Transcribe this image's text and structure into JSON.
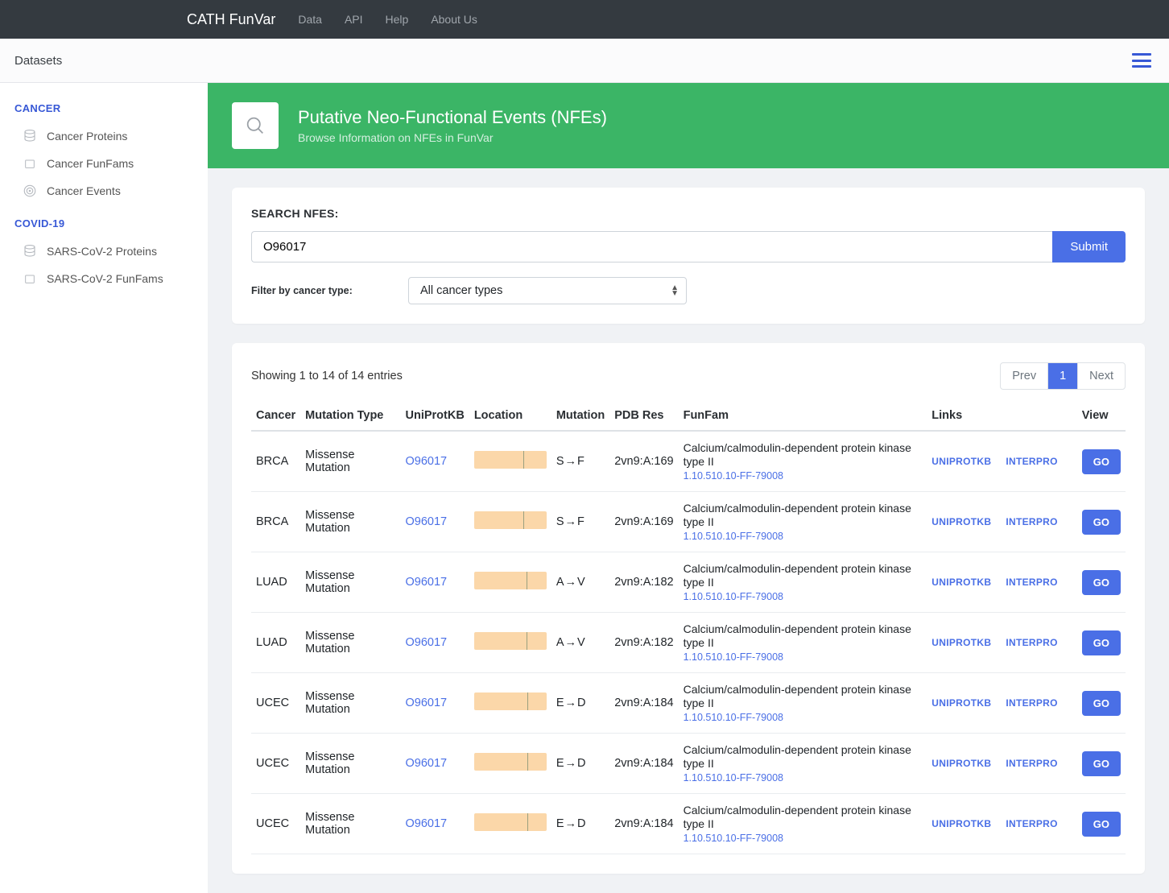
{
  "topnav": {
    "brand": "CATH FunVar",
    "links": [
      "Data",
      "API",
      "Help",
      "About Us"
    ]
  },
  "secbar": {
    "label": "Datasets"
  },
  "sidebar": {
    "groups": [
      {
        "title": "CANCER",
        "items": [
          {
            "label": "Cancer Proteins",
            "icon": "db"
          },
          {
            "label": "Cancer FunFams",
            "icon": "box"
          },
          {
            "label": "Cancer Events",
            "icon": "target"
          }
        ]
      },
      {
        "title": "COVID-19",
        "items": [
          {
            "label": "SARS-CoV-2 Proteins",
            "icon": "db"
          },
          {
            "label": "SARS-CoV-2 FunFams",
            "icon": "box"
          }
        ]
      }
    ]
  },
  "hero": {
    "title": "Putative Neo-Functional Events (NFEs)",
    "subtitle": "Browse Information on NFEs in FunVar"
  },
  "search": {
    "title": "SEARCH NFES:",
    "value": "O96017",
    "submit": "Submit",
    "filter_label": "Filter by cancer type:",
    "filter_value": "All cancer types"
  },
  "pagination": {
    "info": "Showing 1 to 14 of 14 entries",
    "prev": "Prev",
    "pages": [
      "1"
    ],
    "next": "Next",
    "active": "1"
  },
  "table": {
    "headers": [
      "Cancer",
      "Mutation Type",
      "UniProtKB",
      "Location",
      "Mutation",
      "PDB Res",
      "FunFam",
      "Links",
      "View"
    ],
    "link_labels": {
      "uniprot": "UNIPROTKB",
      "interpro": "INTERPRO"
    },
    "go_label": "GO",
    "rows": [
      {
        "cancer": "BRCA",
        "mutation_type": "Missense Mutation",
        "uniprot": "O96017",
        "loc_tick": 68,
        "mutation": "S→F",
        "pdb": "2vn9:A:169",
        "ff_name": "Calcium/calmodulin-dependent protein kinase type II",
        "ff_id": "1.10.510.10-FF-79008"
      },
      {
        "cancer": "BRCA",
        "mutation_type": "Missense Mutation",
        "uniprot": "O96017",
        "loc_tick": 68,
        "mutation": "S→F",
        "pdb": "2vn9:A:169",
        "ff_name": "Calcium/calmodulin-dependent protein kinase type II",
        "ff_id": "1.10.510.10-FF-79008"
      },
      {
        "cancer": "LUAD",
        "mutation_type": "Missense Mutation",
        "uniprot": "O96017",
        "loc_tick": 72,
        "mutation": "A→V",
        "pdb": "2vn9:A:182",
        "ff_name": "Calcium/calmodulin-dependent protein kinase type II",
        "ff_id": "1.10.510.10-FF-79008"
      },
      {
        "cancer": "LUAD",
        "mutation_type": "Missense Mutation",
        "uniprot": "O96017",
        "loc_tick": 72,
        "mutation": "A→V",
        "pdb": "2vn9:A:182",
        "ff_name": "Calcium/calmodulin-dependent protein kinase type II",
        "ff_id": "1.10.510.10-FF-79008"
      },
      {
        "cancer": "UCEC",
        "mutation_type": "Missense Mutation",
        "uniprot": "O96017",
        "loc_tick": 73,
        "mutation": "E→D",
        "pdb": "2vn9:A:184",
        "ff_name": "Calcium/calmodulin-dependent protein kinase type II",
        "ff_id": "1.10.510.10-FF-79008"
      },
      {
        "cancer": "UCEC",
        "mutation_type": "Missense Mutation",
        "uniprot": "O96017",
        "loc_tick": 73,
        "mutation": "E→D",
        "pdb": "2vn9:A:184",
        "ff_name": "Calcium/calmodulin-dependent protein kinase type II",
        "ff_id": "1.10.510.10-FF-79008"
      },
      {
        "cancer": "UCEC",
        "mutation_type": "Missense Mutation",
        "uniprot": "O96017",
        "loc_tick": 73,
        "mutation": "E→D",
        "pdb": "2vn9:A:184",
        "ff_name": "Calcium/calmodulin-dependent protein kinase type II",
        "ff_id": "1.10.510.10-FF-79008"
      }
    ]
  }
}
